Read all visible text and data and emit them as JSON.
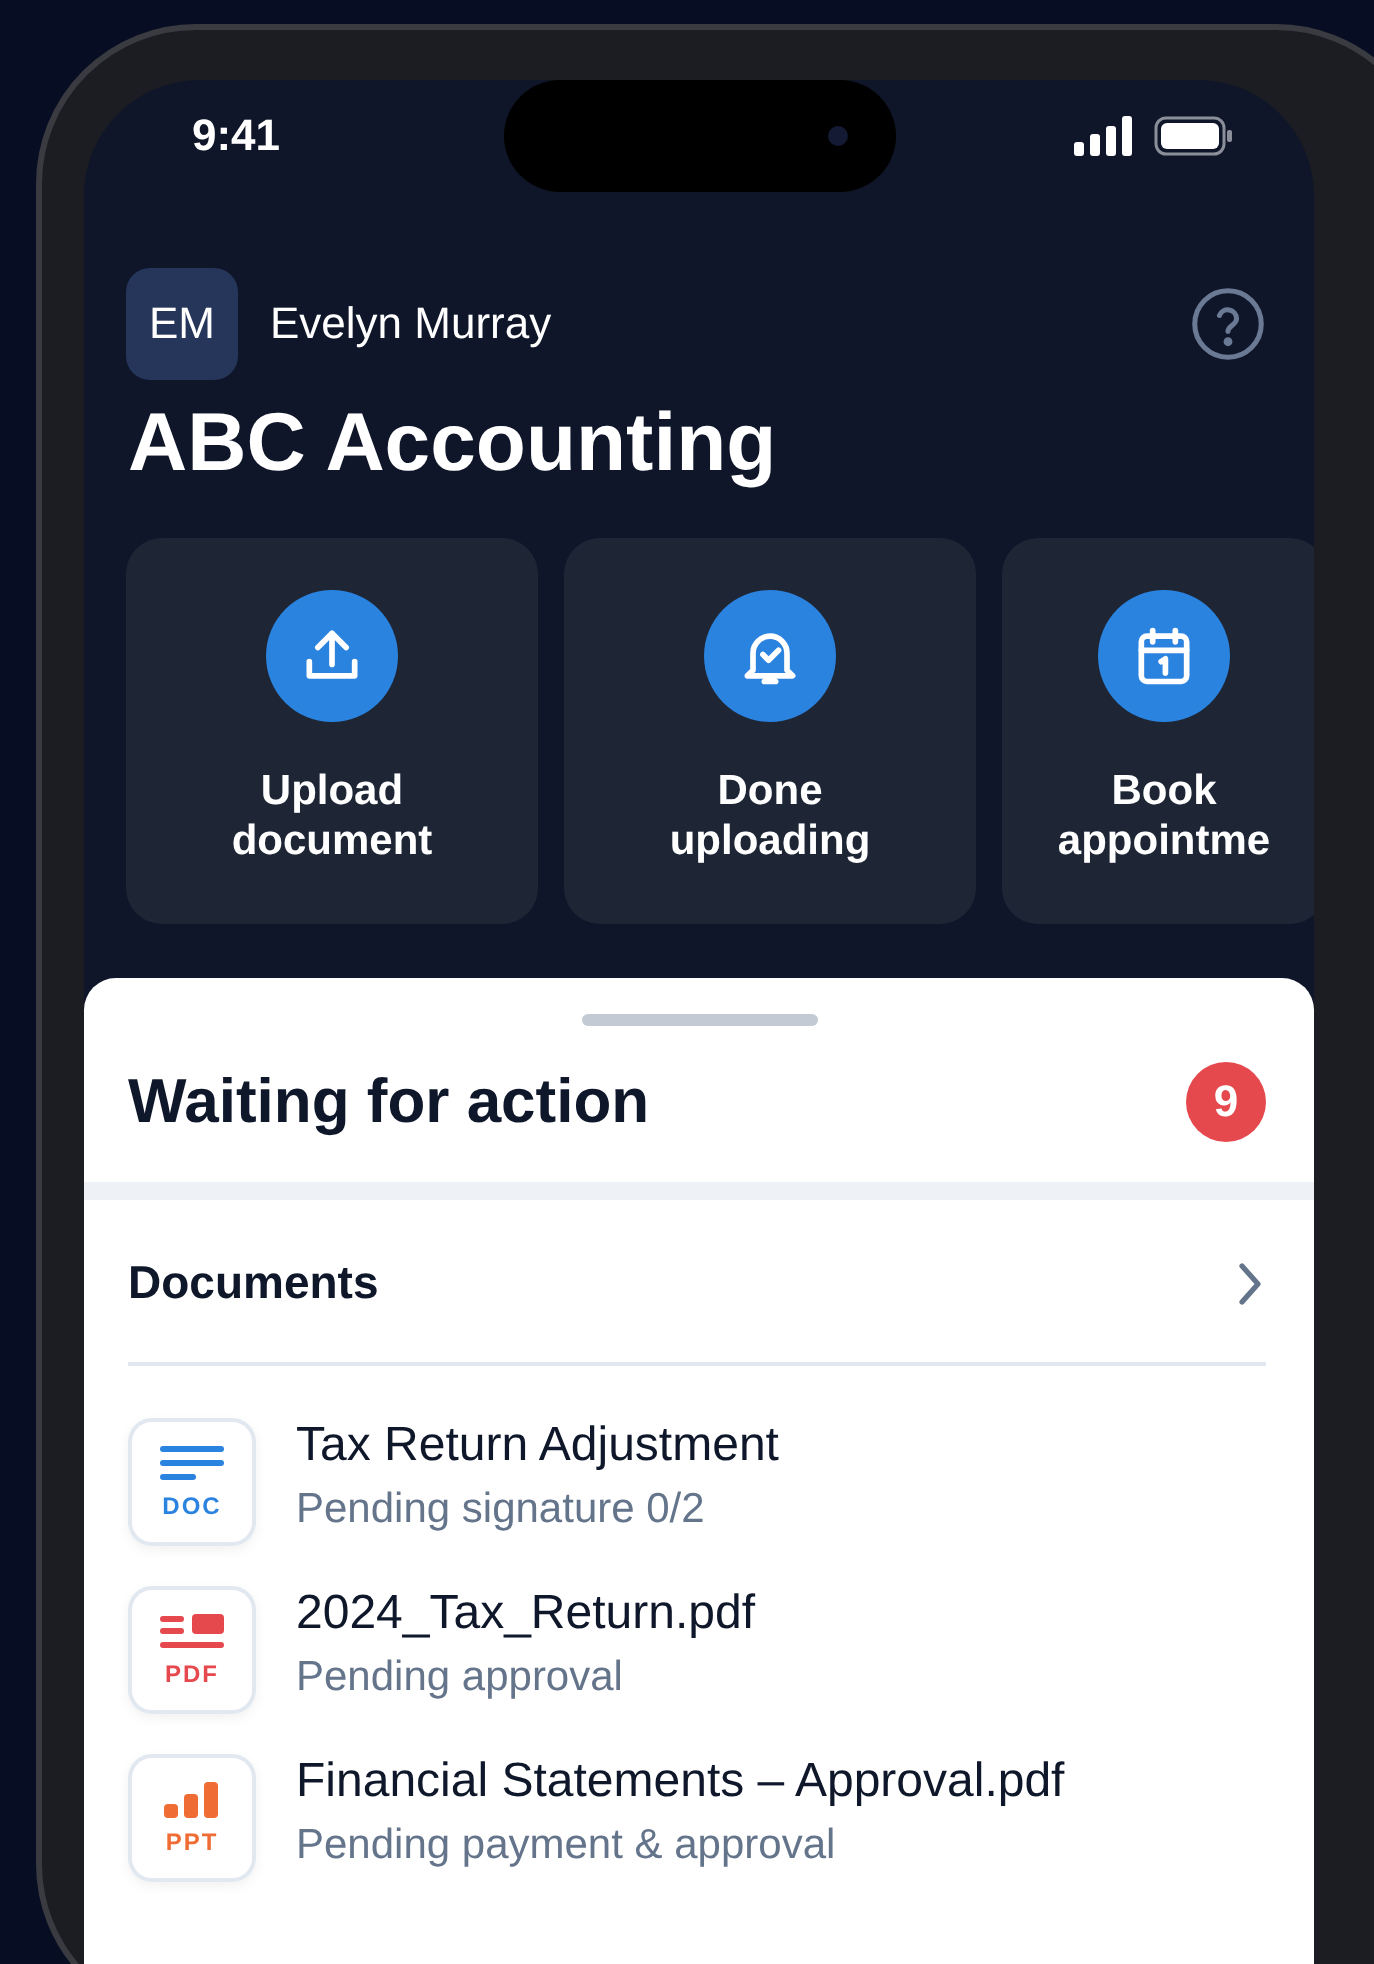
{
  "status_bar": {
    "time": "9:41"
  },
  "header": {
    "initials": "EM",
    "name": "Evelyn Murray",
    "title": "ABC Accounting"
  },
  "actions": [
    {
      "kind": "upload",
      "label": "Upload document"
    },
    {
      "kind": "bell",
      "label": "Done uploading"
    },
    {
      "kind": "calendar",
      "label": "Book appointme"
    }
  ],
  "sheet": {
    "title": "Waiting for action",
    "count": "9"
  },
  "documents": {
    "title": "Documents",
    "items": [
      {
        "kind": "doc",
        "badge": "DOC",
        "name": "Tax Return Adjustment",
        "status": "Pending signature 0/2"
      },
      {
        "kind": "pdf",
        "badge": "PDF",
        "name": "2024_Tax_Return.pdf",
        "status": "Pending approval"
      },
      {
        "kind": "ppt",
        "badge": "PPT",
        "name": "Financial Statements – Approval.pdf",
        "status": "Pending payment & approval"
      }
    ]
  }
}
